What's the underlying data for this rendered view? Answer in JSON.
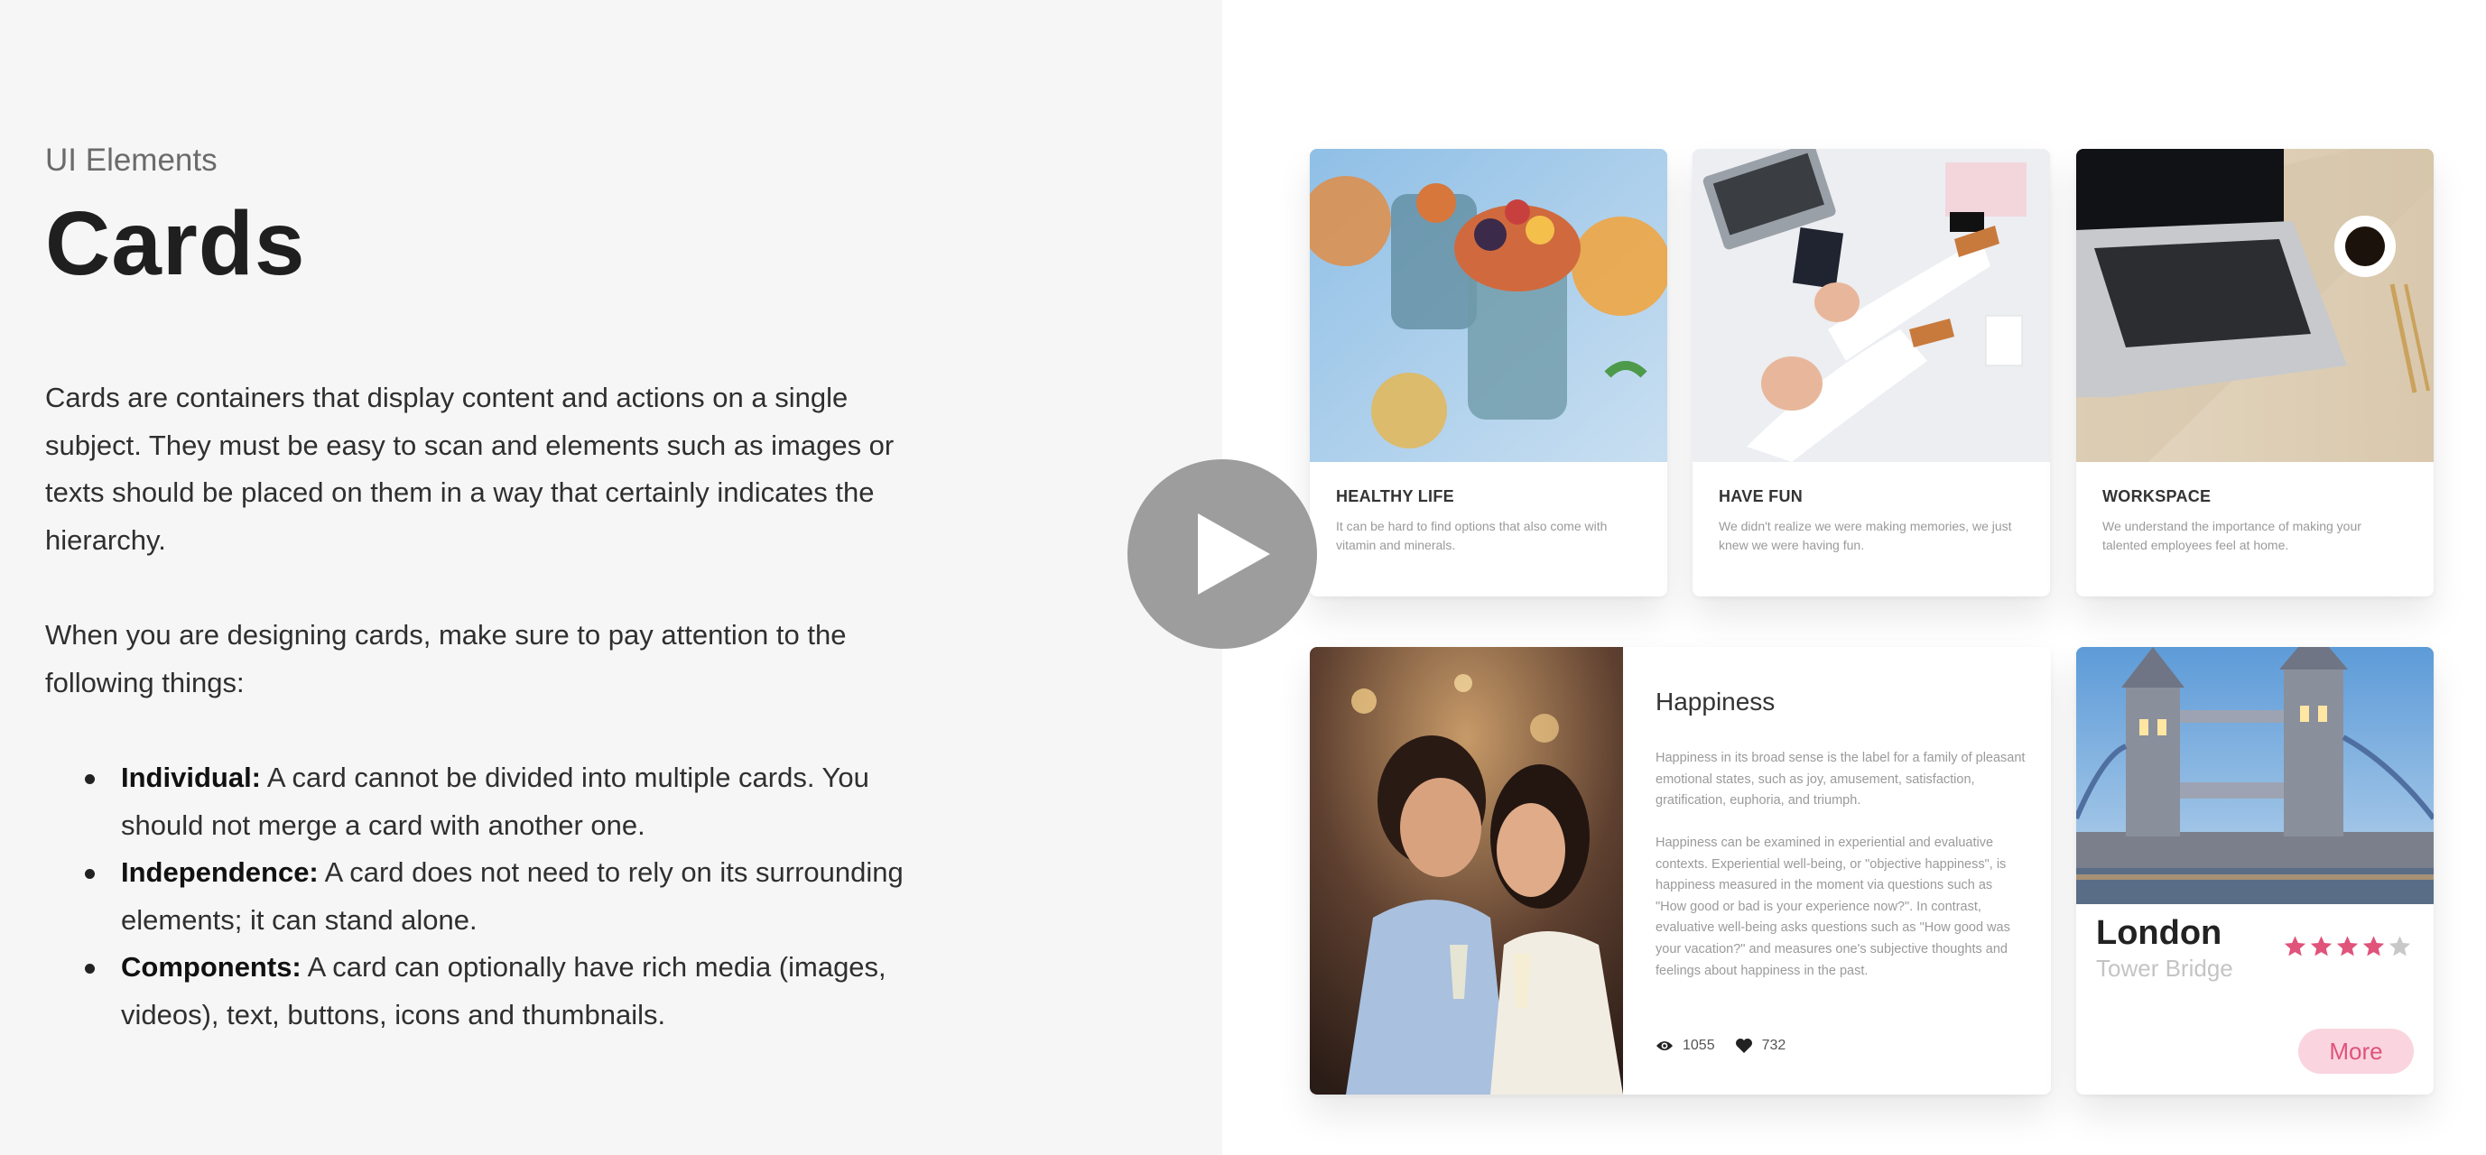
{
  "eyebrow": "UI Elements",
  "title": "Cards",
  "intro": "Cards are containers that display content and actions on a single subject. They must be easy to scan and elements such as images or texts should be placed on them in a way that certainly indicates the hierarchy.",
  "lead": "When you are designing cards, make sure to pay attention to the following things:",
  "bullets": [
    {
      "term": "Individual:",
      "text": " A card cannot be divided into multiple cards. You should not merge a card with another one."
    },
    {
      "term": "Independence:",
      "text": " A card does not need to rely on its surrounding elements; it can stand alone."
    },
    {
      "term": "Components:",
      "text": " A card can optionally have rich media (images, videos), text, buttons, icons and thumbnails."
    }
  ],
  "cards": [
    {
      "title": "HEALTHY LIFE",
      "desc": "It can be hard to find options that also come with vitamin and minerals."
    },
    {
      "title": "HAVE FUN",
      "desc": "We didn't realize we were making memories, we just knew we were having fun."
    },
    {
      "title": "WORKSPACE",
      "desc": "We understand the importance of making your talented employees feel at home."
    }
  ],
  "wide_card": {
    "title": "Happiness",
    "p1": "Happiness in its broad sense is the label for a family of pleasant emotional states, such as joy, amusement, satisfaction, gratification, euphoria, and triumph.",
    "p2": "Happiness can be examined in experiential and evaluative contexts. Experiential well-being, or \"objective happiness\", is happiness measured in the moment via questions such as \"How good or bad is your experience now?\". In contrast, evaluative well-being asks questions such as \"How good was your vacation?\" and measures one's subjective thoughts and feelings about happiness in the past.",
    "views": "1055",
    "likes": "732"
  },
  "london_card": {
    "title": "London",
    "subtitle": "Tower Bridge",
    "rating": 4,
    "rating_max": 5,
    "button": "More"
  },
  "colors": {
    "left_bg": "#f6f6f6",
    "accent_pink": "#e0537b",
    "button_bg": "#fad5df",
    "star_empty": "#c8c8c8",
    "play_bg": "#9d9d9d"
  },
  "icons": {
    "play": "play-icon",
    "views": "eye-icon",
    "likes": "heart-icon",
    "star": "star-icon"
  }
}
